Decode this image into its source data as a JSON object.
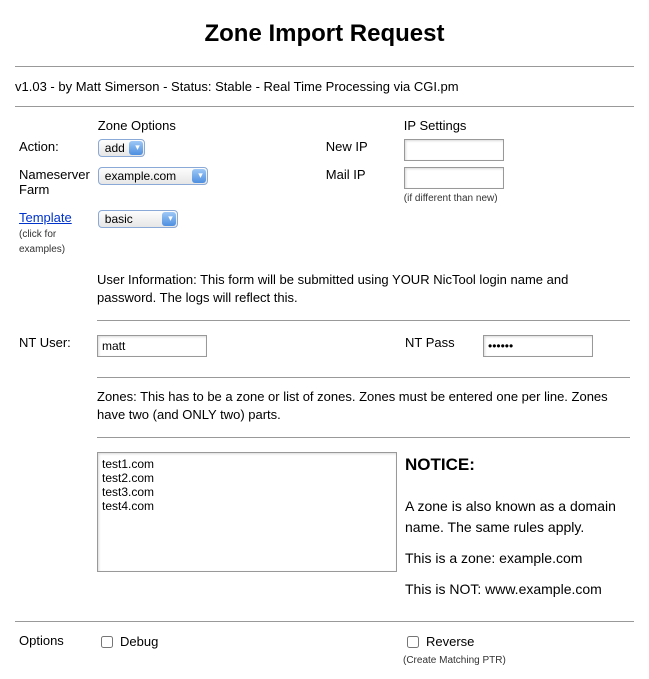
{
  "title": "Zone Import Request",
  "version_line": "v1.03 - by Matt Simerson - Status: Stable - Real Time Processing via CGI.pm",
  "headers": {
    "zone_options": "Zone Options",
    "ip_settings": "IP Settings"
  },
  "labels": {
    "action": "Action:",
    "nameserver_farm": "Nameserver Farm",
    "template": "Template",
    "template_note": "(click for examples)",
    "new_ip": "New IP",
    "mail_ip": "Mail IP",
    "mail_ip_note": "(if different than new)",
    "nt_user": "NT User:",
    "nt_pass": "NT Pass",
    "options": "Options",
    "debug": "Debug",
    "reverse": "Reverse",
    "reverse_note": "(Create Matching PTR)"
  },
  "selects": {
    "action": "add",
    "farm": "example.com",
    "template": "basic"
  },
  "inputs": {
    "new_ip": "",
    "mail_ip": "",
    "nt_user": "matt",
    "nt_pass": "••••••",
    "zones": "test1.com\ntest2.com\ntest3.com\ntest4.com"
  },
  "info": {
    "user_info": "User Information: This form will be submitted using YOUR NicTool login name and password. The logs will reflect this.",
    "zones_info": "Zones: This has to be a zone or list of zones. Zones must be entered one per line. Zones have two (and ONLY two) parts."
  },
  "notice": {
    "heading": "NOTICE:",
    "p1": "A zone is also known as a domain name. The same rules apply.",
    "p2": "This is a zone: example.com",
    "p3": "This is NOT: www.example.com"
  }
}
